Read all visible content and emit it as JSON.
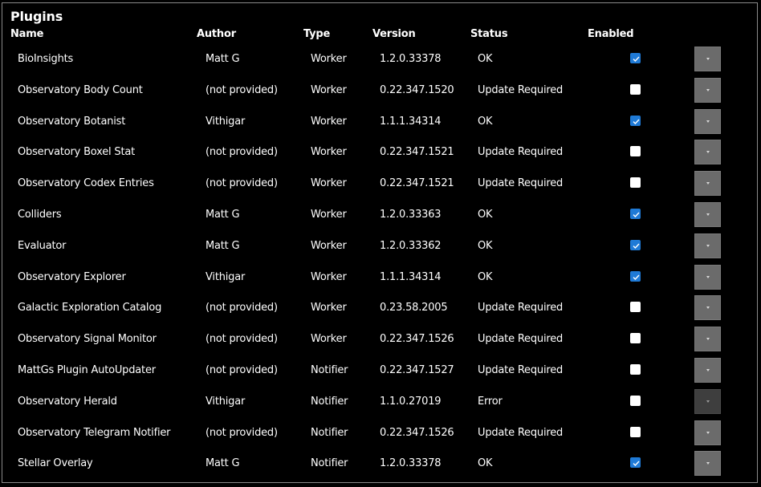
{
  "panel": {
    "title": "Plugins"
  },
  "columns": {
    "name": "Name",
    "author": "Author",
    "type": "Type",
    "version": "Version",
    "status": "Status",
    "enabled": "Enabled"
  },
  "colors": {
    "background": "#000000",
    "checkbox_checked": "#1f7ad6",
    "dropdown_button": "#6b6b6b",
    "dropdown_button_disabled": "#3e3e3e"
  },
  "rows": [
    {
      "name": "BioInsights",
      "author": "Matt G",
      "type": "Worker",
      "version": "1.2.0.33378",
      "status": "OK",
      "enabled": true,
      "dropdown_disabled": false
    },
    {
      "name": "Observatory Body Count",
      "author": "(not provided)",
      "type": "Worker",
      "version": "0.22.347.1520",
      "status": "Update Required",
      "enabled": false,
      "dropdown_disabled": false
    },
    {
      "name": "Observatory Botanist",
      "author": "Vithigar",
      "type": "Worker",
      "version": "1.1.1.34314",
      "status": "OK",
      "enabled": true,
      "dropdown_disabled": false
    },
    {
      "name": "Observatory Boxel Stat",
      "author": "(not provided)",
      "type": "Worker",
      "version": "0.22.347.1521",
      "status": "Update Required",
      "enabled": false,
      "dropdown_disabled": false
    },
    {
      "name": "Observatory Codex Entries",
      "author": "(not provided)",
      "type": "Worker",
      "version": "0.22.347.1521",
      "status": "Update Required",
      "enabled": false,
      "dropdown_disabled": false
    },
    {
      "name": "Colliders",
      "author": "Matt G",
      "type": "Worker",
      "version": "1.2.0.33363",
      "status": "OK",
      "enabled": true,
      "dropdown_disabled": false
    },
    {
      "name": "Evaluator",
      "author": "Matt G",
      "type": "Worker",
      "version": "1.2.0.33362",
      "status": "OK",
      "enabled": true,
      "dropdown_disabled": false
    },
    {
      "name": "Observatory Explorer",
      "author": "Vithigar",
      "type": "Worker",
      "version": "1.1.1.34314",
      "status": "OK",
      "enabled": true,
      "dropdown_disabled": false
    },
    {
      "name": "Galactic Exploration Catalog",
      "author": "(not provided)",
      "type": "Worker",
      "version": "0.23.58.2005",
      "status": "Update Required",
      "enabled": false,
      "dropdown_disabled": false
    },
    {
      "name": "Observatory Signal Monitor",
      "author": "(not provided)",
      "type": "Worker",
      "version": "0.22.347.1526",
      "status": "Update Required",
      "enabled": false,
      "dropdown_disabled": false
    },
    {
      "name": "MattGs Plugin AutoUpdater",
      "author": "(not provided)",
      "type": "Notifier",
      "version": "0.22.347.1527",
      "status": "Update Required",
      "enabled": false,
      "dropdown_disabled": false
    },
    {
      "name": "Observatory Herald",
      "author": "Vithigar",
      "type": "Notifier",
      "version": "1.1.0.27019",
      "status": "Error",
      "enabled": false,
      "dropdown_disabled": true
    },
    {
      "name": "Observatory Telegram Notifier",
      "author": "(not provided)",
      "type": "Notifier",
      "version": "0.22.347.1526",
      "status": "Update Required",
      "enabled": false,
      "dropdown_disabled": false
    },
    {
      "name": "Stellar Overlay",
      "author": "Matt G",
      "type": "Notifier",
      "version": "1.2.0.33378",
      "status": "OK",
      "enabled": true,
      "dropdown_disabled": false
    }
  ]
}
